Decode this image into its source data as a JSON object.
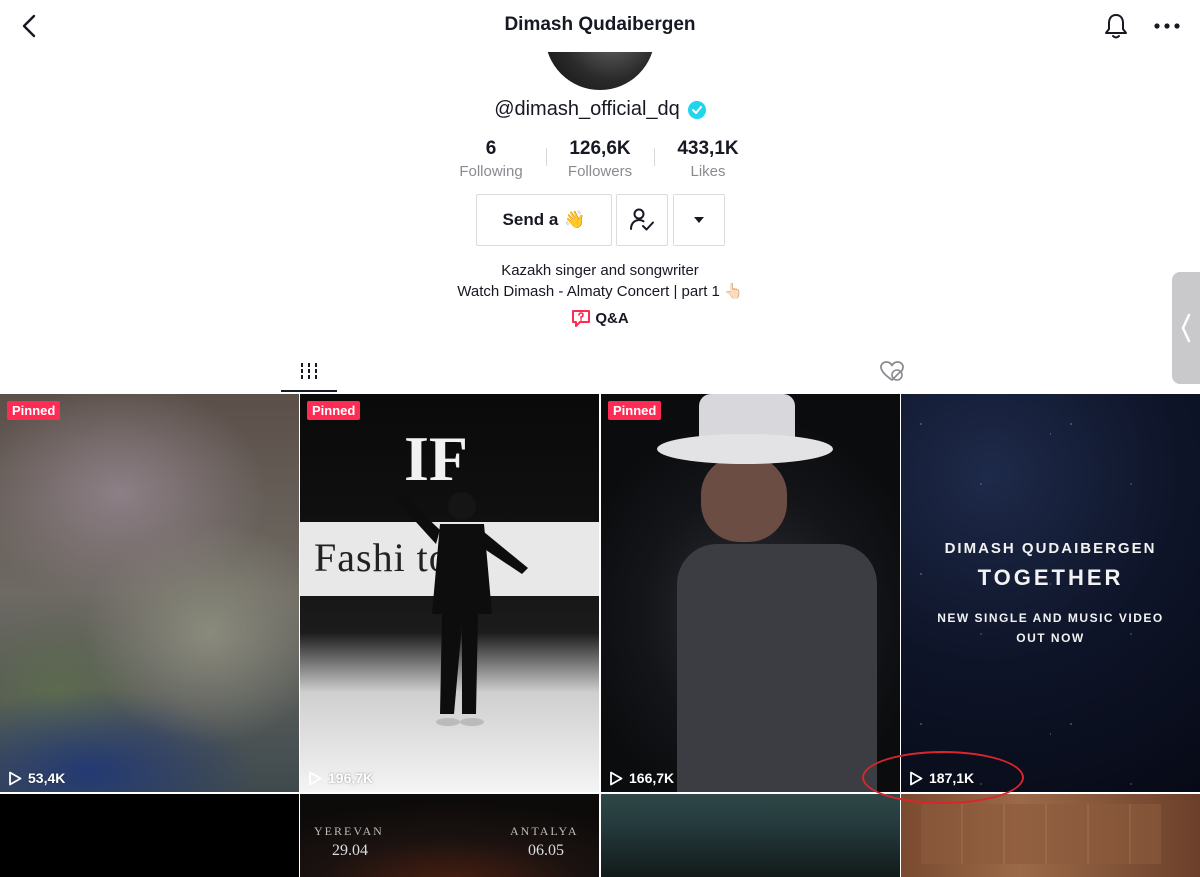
{
  "header": {
    "title": "Dimash Qudaibergen",
    "back_icon": "chevron-left-icon",
    "bell_icon": "bell-icon",
    "more_icon": "more-horizontal-icon"
  },
  "profile": {
    "handle": "@dimash_official_dq",
    "verified": true,
    "stats": [
      {
        "value": "6",
        "label": "Following"
      },
      {
        "value": "126,6K",
        "label": "Followers"
      },
      {
        "value": "433,1K",
        "label": "Likes"
      }
    ],
    "send_label": "Send a",
    "send_emoji": "👋",
    "bio_line1": "Kazakh singer and songwriter",
    "bio_line2": "Watch Dimash - Almaty Concert | part 1 👆🏻",
    "qa_label": "Q&A"
  },
  "tabs": [
    {
      "name": "videos",
      "icon": "grid-lines-icon",
      "active": true
    },
    {
      "name": "liked",
      "icon": "liked-hidden-icon",
      "active": false
    }
  ],
  "videos": [
    {
      "pinned_label": "Pinned",
      "views": "53,4K"
    },
    {
      "pinned_label": "Pinned",
      "views": "196,7K",
      "overlay_logo": "IF",
      "overlay_text": "Fashi       tor"
    },
    {
      "pinned_label": "Pinned",
      "views": "166,7K"
    },
    {
      "views": "187,1K",
      "artist": "DIMASH QUDAIBERGEN",
      "song": "TOGETHER",
      "sub1": "NEW SINGLE AND MUSIC VIDEO",
      "sub2": "OUT NOW"
    },
    {},
    {
      "city1": "YEREVAN",
      "date1": "29.04",
      "city2": "ANTALYA",
      "date2": "06.05"
    },
    {},
    {}
  ],
  "colors": {
    "accent": "#fe2c55",
    "verified": "#20d5ec",
    "annotation": "#d9262c",
    "text": "#161823",
    "muted": "#8a8b91"
  }
}
